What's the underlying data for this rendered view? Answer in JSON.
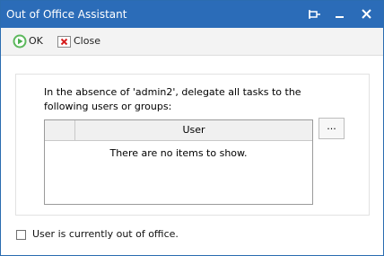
{
  "window": {
    "title": "Out of Office Assistant",
    "controls": {
      "pin": "pin-icon",
      "minimize": "minimize-icon",
      "close": "close-icon"
    },
    "titlebar_color": "#2b6cb8"
  },
  "toolbar": {
    "ok_label": "OK",
    "close_label": "Close"
  },
  "delegate_panel": {
    "instruction": "In the absence of 'admin2', delegate all tasks to the following users or groups:",
    "list": {
      "columns": [
        "User"
      ],
      "empty_message": "There are no items to show."
    },
    "browse_label": "..."
  },
  "out_of_office": {
    "checkbox_label": "User is currently out of office.",
    "checked": false
  }
}
